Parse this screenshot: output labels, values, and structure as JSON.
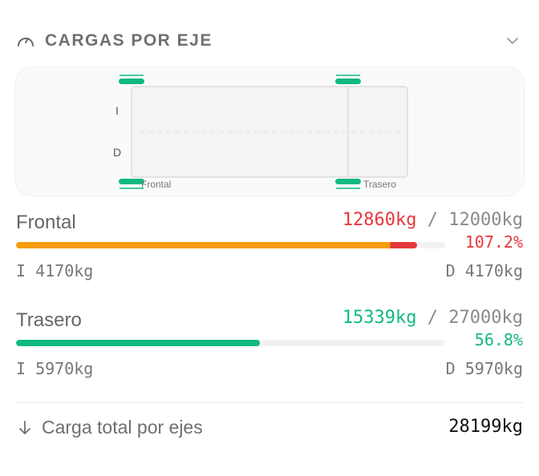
{
  "header": {
    "title": "CARGAS POR EJE",
    "icon": "gauge-icon",
    "toggle_icon": "chevron-down-icon"
  },
  "diagram": {
    "side_left": "I",
    "side_right": "D",
    "front_label": "Frontal",
    "rear_label": "Trasero"
  },
  "axles": [
    {
      "name": "Frontal",
      "current": "12860kg",
      "separator": "/",
      "max": "12000kg",
      "percent": "107.2%",
      "percent_value": 107.2,
      "status": "over",
      "left": "I 4170kg",
      "right": "D 4170kg"
    },
    {
      "name": "Trasero",
      "current": "15339kg",
      "separator": "/",
      "max": "27000kg",
      "percent": "56.8%",
      "percent_value": 56.8,
      "status": "ok",
      "left": "I 5970kg",
      "right": "D 5970kg"
    }
  ],
  "total": {
    "label": "Carga total por ejes",
    "value": "28199kg",
    "icon": "arrow-down-icon"
  },
  "colors": {
    "green": "#10b981",
    "red": "#e5383b",
    "orange": "#f59e0b",
    "track": "#f2f2f2"
  }
}
